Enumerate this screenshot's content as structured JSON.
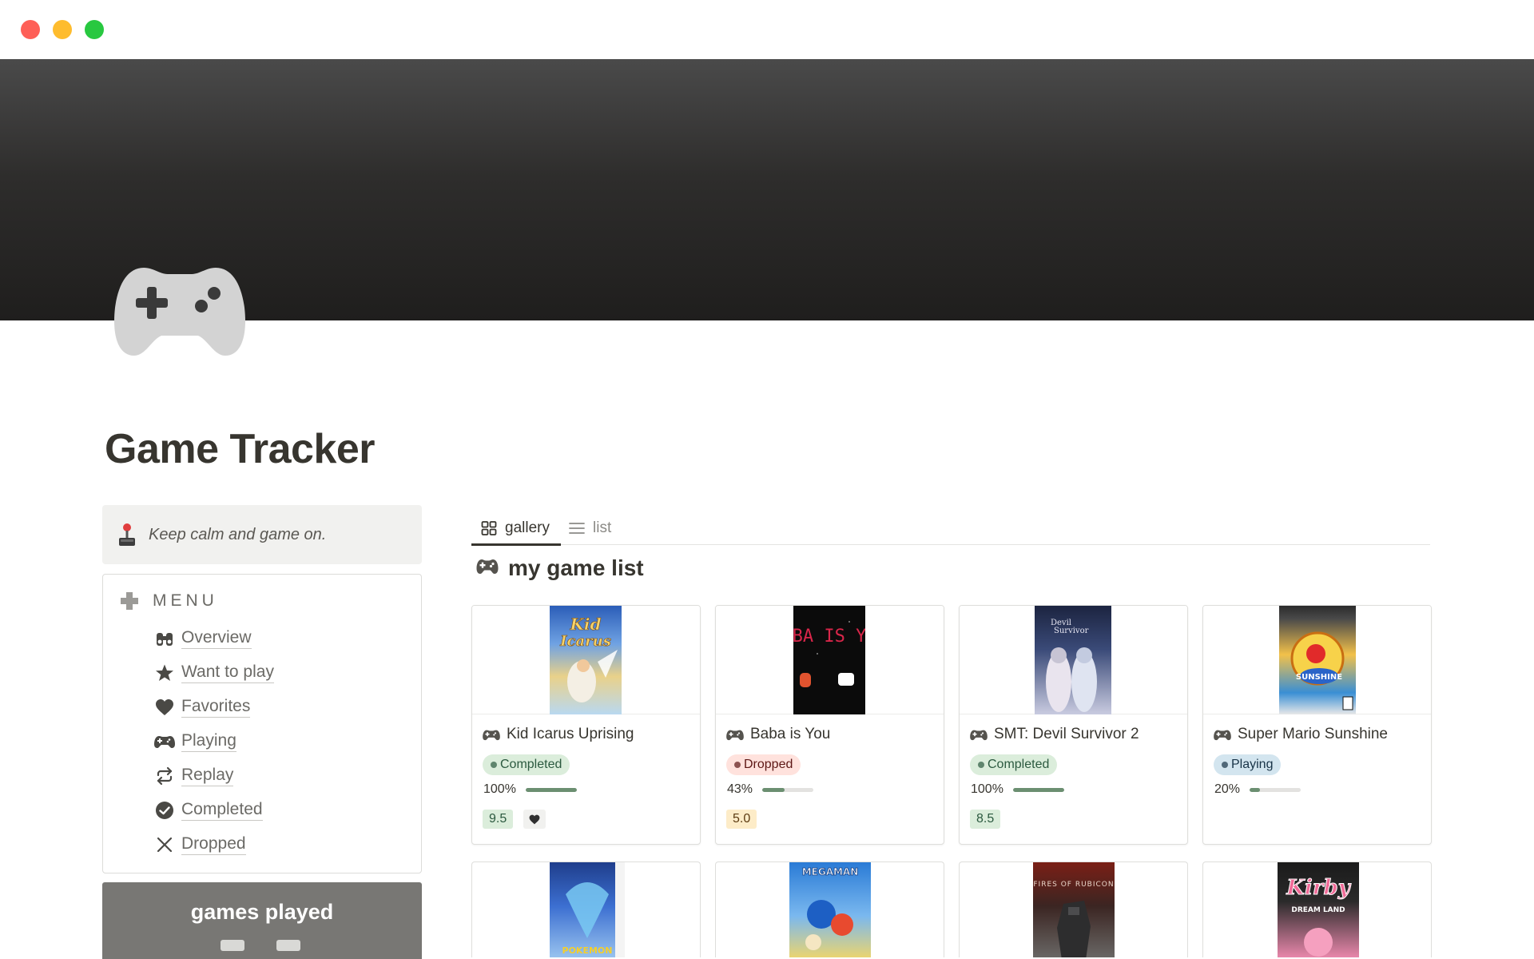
{
  "window": {
    "controls": [
      "close",
      "minimize",
      "maximize"
    ]
  },
  "page": {
    "title": "Game Tracker",
    "icon": "gamepad-icon"
  },
  "callout": {
    "icon": "joystick-icon",
    "text": "Keep calm and game on."
  },
  "menu": {
    "heading": "MENU",
    "heading_icon": "dpad-icon",
    "items": [
      {
        "label": "Overview",
        "icon": "binoculars-icon"
      },
      {
        "label": "Want to play",
        "icon": "star-icon"
      },
      {
        "label": "Favorites",
        "icon": "heart-icon"
      },
      {
        "label": "Playing",
        "icon": "controller-icon"
      },
      {
        "label": "Replay",
        "icon": "repeat-icon"
      },
      {
        "label": "Completed",
        "icon": "check-circle-icon"
      },
      {
        "label": "Dropped",
        "icon": "x-icon"
      }
    ]
  },
  "games_played": {
    "title": "games played"
  },
  "views": {
    "tabs": [
      {
        "label": "gallery",
        "icon": "grid-icon",
        "active": true
      },
      {
        "label": "list",
        "icon": "list-icon",
        "active": false
      }
    ]
  },
  "section": {
    "title": "my game list",
    "icon": "gamepad-icon"
  },
  "colors": {
    "completed_bg": "#dbeddb",
    "completed_fg": "#2b593f",
    "dropped_bg": "#ffe2dd",
    "dropped_fg": "#5d1715",
    "playing_bg": "#d3e5ef",
    "playing_fg": "#183347",
    "score_green_bg": "#dbeddb",
    "score_yellow_bg": "#fdecc8",
    "progress_fill": "#6b8f71"
  },
  "games": [
    {
      "name": "Kid Icarus Uprising",
      "status": "Completed",
      "progress_label": "100%",
      "progress": 1.0,
      "score": "9.5",
      "favorite": true
    },
    {
      "name": "Baba is You",
      "status": "Dropped",
      "progress_label": "43%",
      "progress": 0.43,
      "score": "5.0",
      "favorite": false
    },
    {
      "name": "SMT: Devil Survivor 2",
      "status": "Completed",
      "progress_label": "100%",
      "progress": 1.0,
      "score": "8.5",
      "favorite": false
    },
    {
      "name": "Super Mario Sunshine",
      "status": "Playing",
      "progress_label": "20%",
      "progress": 0.2,
      "score": "",
      "favorite": false
    }
  ],
  "games_row2": [
    "pokemon-cover",
    "megaman-cover",
    "armored-core-cover",
    "kirby-cover"
  ]
}
